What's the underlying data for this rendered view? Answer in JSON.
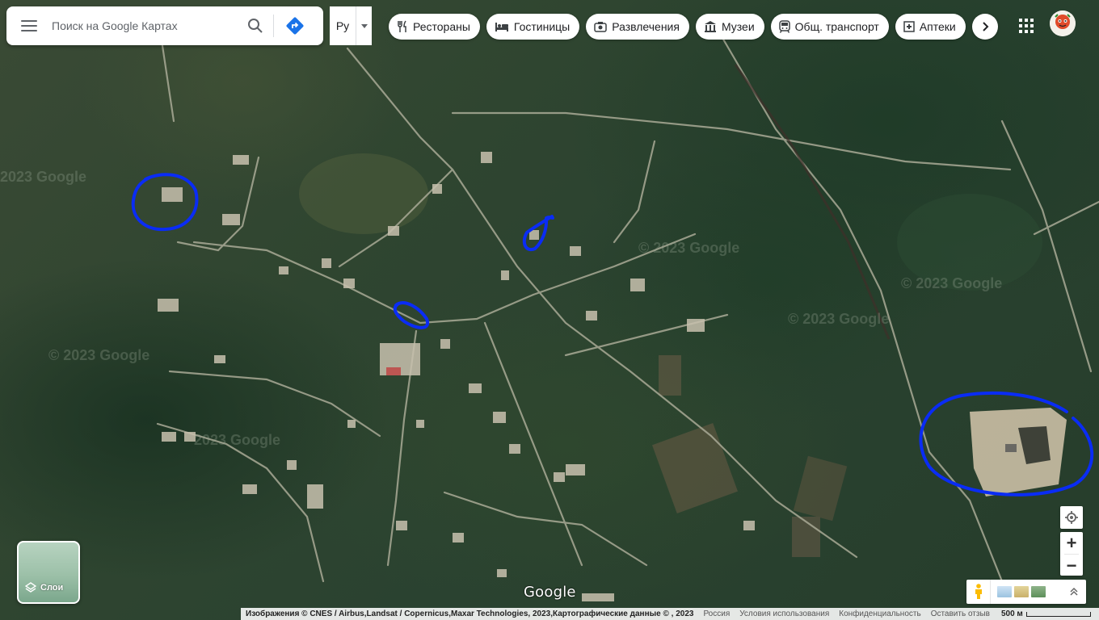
{
  "search": {
    "placeholder": "Поиск на Google Картах",
    "menu_icon": "hamburger-menu-icon",
    "search_icon": "magnifier-icon",
    "directions_icon": "directions-icon"
  },
  "language": {
    "label": "Ру"
  },
  "categories": [
    {
      "label": "Рестораны",
      "icon": "fork-knife-icon"
    },
    {
      "label": "Гостиницы",
      "icon": "bed-icon"
    },
    {
      "label": "Развлечения",
      "icon": "camera-icon"
    },
    {
      "label": "Музеи",
      "icon": "museum-icon"
    },
    {
      "label": "Общ. транспорт",
      "icon": "train-icon"
    },
    {
      "label": "Аптеки",
      "icon": "pharmacy-icon"
    }
  ],
  "header": {
    "apps_icon": "apps-grid-icon",
    "avatar_icon": "user-avatar-icon"
  },
  "layers": {
    "label": "Слои",
    "icon": "layers-icon"
  },
  "map": {
    "view": "satellite",
    "watermark": "© 2023 Google",
    "annotations_color": "#0a2cf5",
    "logo": "Google"
  },
  "controls": {
    "locate_icon": "my-location-icon",
    "zoom_in": "+",
    "zoom_out": "−",
    "pegman_icon": "pegman-icon",
    "expand_icon": "chevron-up-icon"
  },
  "footer": {
    "attribution": "Изображения © CNES / Airbus,Landsat / Copernicus,Maxar Technologies, 2023,Картографические данные © , 2023",
    "country": "Россия",
    "terms": "Условия использования",
    "privacy": "Конфиденциальность",
    "feedback": "Оставить отзыв",
    "scale": "500 м"
  }
}
